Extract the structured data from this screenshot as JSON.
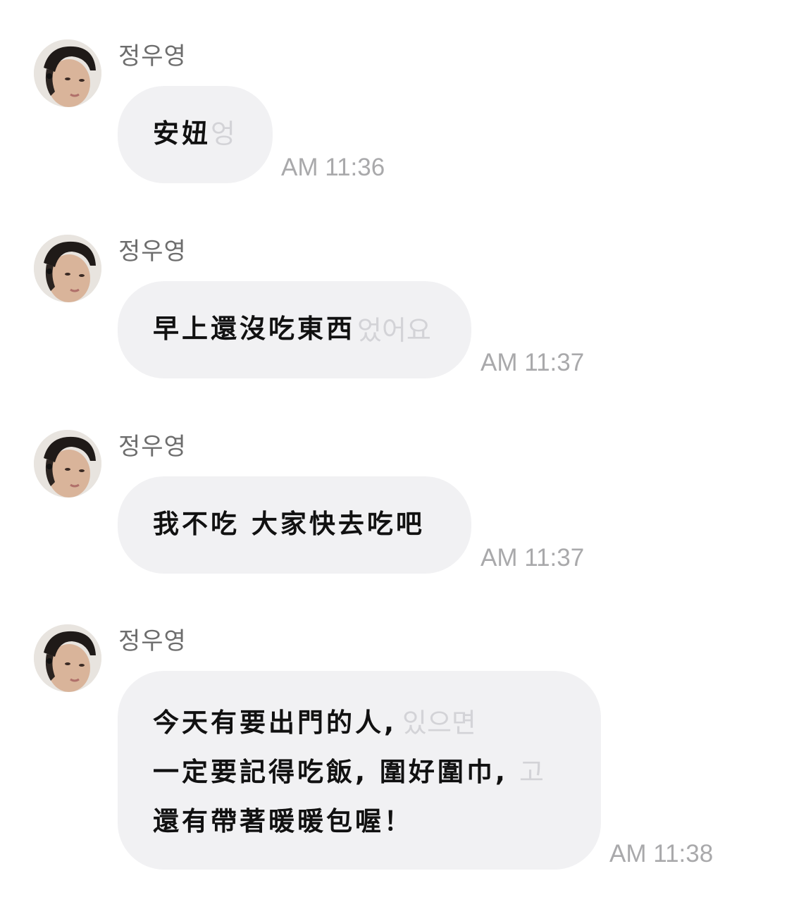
{
  "messages": [
    {
      "sender": "정우영",
      "lines": [
        "安妞"
      ],
      "ghost": [
        "엉"
      ],
      "time": "AM 11:36"
    },
    {
      "sender": "정우영",
      "lines": [
        "早上還沒吃東西"
      ],
      "ghost": [
        "었어요"
      ],
      "time": "AM 11:37"
    },
    {
      "sender": "정우영",
      "lines": [
        "我不吃 大家快去吃吧"
      ],
      "time": "AM 11:37"
    },
    {
      "sender": "정우영",
      "lines": [
        "今天有要出門的人,",
        "一定要記得吃飯, 圍好圍巾,",
        "還有帶著暖暖包喔！"
      ],
      "ghost": [
        "있으면",
        "고"
      ],
      "time": "AM 11:38"
    }
  ]
}
